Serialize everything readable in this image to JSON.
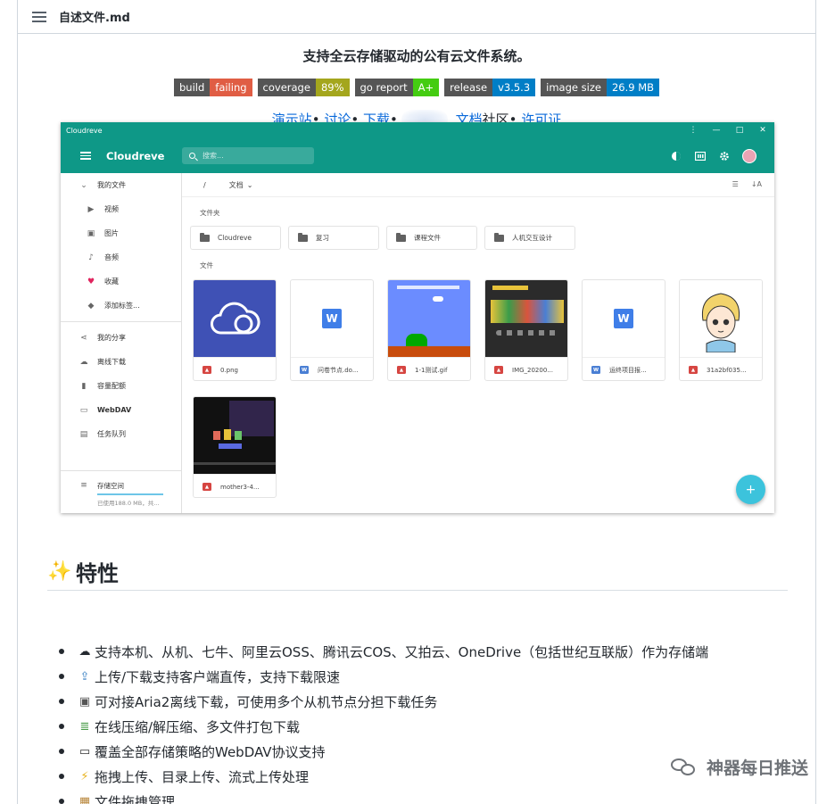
{
  "header": {
    "file_name": "自述文件.md"
  },
  "readme": {
    "tagline": "支持全云存储驱动的公有云文件系统。",
    "badges": [
      {
        "label": "build",
        "value": "failing",
        "color": "#e05d44"
      },
      {
        "label": "coverage",
        "value": "89%",
        "color": "#a4a61d"
      },
      {
        "label": "go report",
        "value": "A+",
        "color": "#4c1"
      },
      {
        "label": "release",
        "value": "v3.5.3",
        "color": "#007ec6"
      },
      {
        "label": "image size",
        "value": "26.9 MB",
        "color": "#007ec6"
      }
    ],
    "links": {
      "demo": "演示站",
      "discuss": "讨论",
      "download": "下载",
      "docs": "文档",
      "community": "社区",
      "license": "许可证",
      "sep": "•"
    }
  },
  "app": {
    "window_title": "Cloudreve",
    "app_title": "Cloudreve",
    "search_placeholder": "搜索...",
    "breadcrumb": {
      "root": "/",
      "current": "文档"
    },
    "drawer": {
      "my_files": "我的文件",
      "items": [
        "视频",
        "图片",
        "音频",
        "收藏",
        "添加标签..."
      ],
      "items2": [
        "我的分享",
        "离线下载",
        "容量配额",
        "WebDAV",
        "任务队列"
      ],
      "storage_label": "存储空间",
      "storage_used": "已使用188.0 MB，共..."
    },
    "folders_label": "文件夹",
    "folders": [
      "Cloudreve",
      "复习",
      "课程文件",
      "人机交互设计"
    ],
    "files_label": "文件",
    "files": [
      {
        "name": "0.png",
        "type": "img"
      },
      {
        "name": "问卷节点.do...",
        "type": "doc"
      },
      {
        "name": "1-1测试.gif",
        "type": "img"
      },
      {
        "name": "IMG_20200...",
        "type": "img"
      },
      {
        "name": "运终项目报...",
        "type": "doc"
      },
      {
        "name": "31a2bf035...",
        "type": "img"
      },
      {
        "name": "mother3-4...",
        "type": "img"
      }
    ],
    "accent": "#0e9887"
  },
  "features": {
    "title": "特性",
    "items": [
      {
        "icon": "cloud-icon",
        "text": "支持本机、从机、七牛、阿里云OSS、腾讯云COS、又拍云、OneDrive（包括世纪互联版）作为存储端"
      },
      {
        "icon": "upload-icon",
        "text": "上传/下载支持客户端直传，支持下载限速"
      },
      {
        "icon": "floppy-disk-icon",
        "text": "可对接Aria2离线下载，可使用多个从机节点分担下载任务"
      },
      {
        "icon": "books-icon",
        "text": "在线压缩/解压缩、多文件打包下载"
      },
      {
        "icon": "laptop-icon",
        "text": "覆盖全部存储策略的WebDAV协议支持"
      },
      {
        "icon": "lightning-icon",
        "text": "拖拽上传、目录上传、流式上传处理"
      },
      {
        "icon": "package-icon",
        "text": "文件拖拽管理"
      }
    ]
  },
  "watermark": "神器每日推送"
}
